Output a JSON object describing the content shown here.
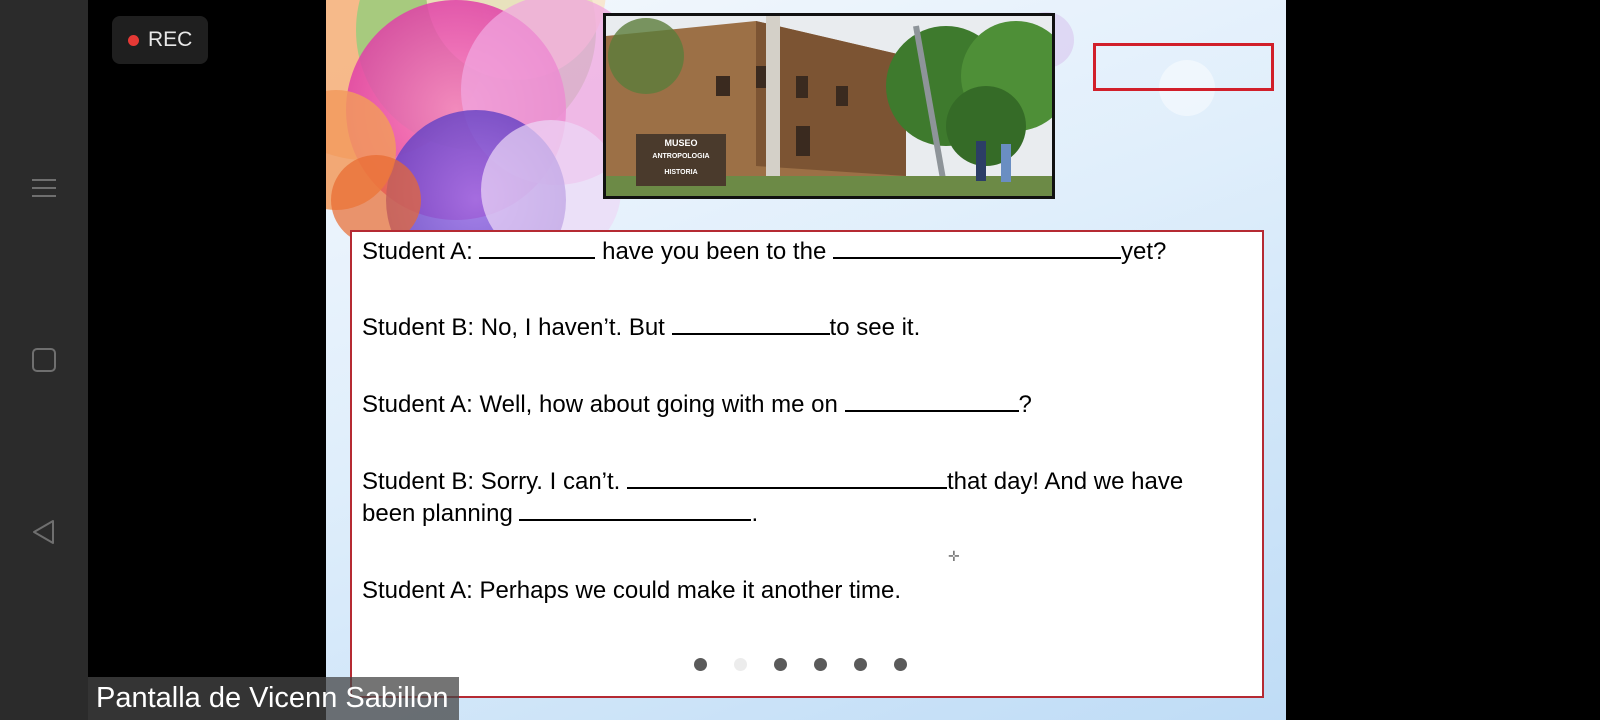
{
  "recording": {
    "label": "REC",
    "dot_color": "#e53935"
  },
  "android_nav": {
    "menu_icon": "menu-icon",
    "home_icon": "square-home-icon",
    "back_icon": "triangle-back-icon"
  },
  "slide": {
    "photo": {
      "sign": {
        "line1": "MUSEO",
        "line2": "ANTROPOLOGIA",
        "line3": "HISTORIA"
      }
    },
    "highlight_color": "#d11f2a",
    "dialog": [
      {
        "speaker": "Student A:",
        "parts": [
          "",
          "have you been to the",
          "yet?"
        ]
      },
      {
        "speaker": "Student B:",
        "parts": [
          "No, I haven’t. But",
          "to see it."
        ]
      },
      {
        "speaker": "Student A:",
        "parts": [
          "Well, how about going with me on",
          "?"
        ]
      },
      {
        "speaker": "Student B:",
        "parts": [
          "Sorry. I can’t.",
          "that day! And we have"
        ]
      },
      {
        "continuation": [
          "been planning",
          "."
        ]
      },
      {
        "speaker": "Student A:",
        "parts": [
          "Perhaps we could make it another time."
        ]
      }
    ],
    "pagination": {
      "total": 6,
      "active_index": 1
    }
  },
  "presenter_label": "Pantalla de Vicenn Sabillon"
}
